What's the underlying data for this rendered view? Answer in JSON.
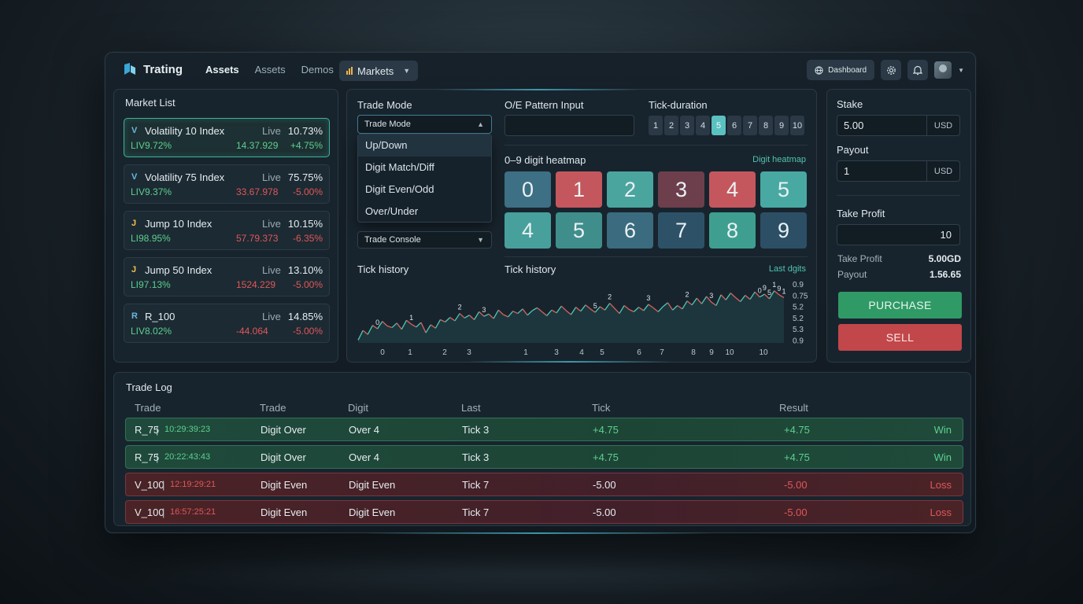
{
  "header": {
    "brand": "Trating",
    "nav": [
      "Assets",
      "Assets",
      "Demos"
    ],
    "markets_label": "Markets",
    "dashboard_label": "Dashboard"
  },
  "market_list": {
    "title": "Market List",
    "live_label": "Live",
    "items": [
      {
        "icon": "V",
        "name": "Volatility 10 Index",
        "pct": "10.73%",
        "sub": "LIV9.72%",
        "price": "14.37.929",
        "price_color": "green",
        "change": "+4.75%",
        "change_color": "green"
      },
      {
        "icon": "V",
        "name": "Volatility 75 Index",
        "pct": "75.75%",
        "sub": "LIV9.37%",
        "price": "33.67.978",
        "price_color": "red",
        "change": "-5.00%",
        "change_color": "red"
      },
      {
        "icon": "J",
        "name": "Jump 10 Index",
        "pct": "10.15%",
        "sub": "LI98.95%",
        "price": "57.79.373",
        "price_color": "red",
        "change": "-6.35%",
        "change_color": "red"
      },
      {
        "icon": "J",
        "name": "Jump 50 Index",
        "pct": "13.10%",
        "sub": "LI97.13%",
        "price": "1524.229",
        "price_color": "red",
        "change": "-5.00%",
        "change_color": "red"
      },
      {
        "icon": "R",
        "name": "R_100",
        "pct": "14.85%",
        "sub": "LIV8.02%",
        "price": "-44.064",
        "price_color": "red",
        "change": "-5.00%",
        "change_color": "red"
      }
    ]
  },
  "center": {
    "trade_mode_label": "Trade Mode",
    "trade_mode_value": "Trade Mode",
    "dropdown_options": [
      "Up/Down",
      "Digit Match/Diff",
      "Digit Even/Odd",
      "Over/Under"
    ],
    "trade_console_value": "Trade Console",
    "pattern_label": "O/E Pattern Input",
    "pattern_value": "",
    "tick_duration_label": "Tick-duration",
    "tick_options": [
      "1",
      "2",
      "3",
      "4",
      "5",
      "6",
      "7",
      "8",
      "9",
      "10"
    ],
    "tick_selected": "5",
    "heatmap_title": "0–9 digit heatmap",
    "heatmap_link": "Digit heatmap",
    "heatmap_cells": [
      {
        "digit": "0",
        "color": "#3d6f85"
      },
      {
        "digit": "1",
        "color": "#c4575d"
      },
      {
        "digit": "2",
        "color": "#4aa59e"
      },
      {
        "digit": "3",
        "color": "#6d3f4c"
      },
      {
        "digit": "4",
        "color": "#c4575d"
      },
      {
        "digit": "5",
        "color": "#48a9a3"
      },
      {
        "digit": "4",
        "color": "#47a09b"
      },
      {
        "digit": "5",
        "color": "#3f8e8c"
      },
      {
        "digit": "6",
        "color": "#3a6b7e"
      },
      {
        "digit": "7",
        "color": "#2d5268"
      },
      {
        "digit": "8",
        "color": "#3e9f90"
      },
      {
        "digit": "9",
        "color": "#2c4f66"
      }
    ],
    "tick_history_a": "Tick history",
    "tick_history_b": "Tick history",
    "last_digits_label": "Last dgits"
  },
  "chart_data": {
    "type": "line",
    "x_ticks": [
      "0",
      "1",
      "2",
      "3",
      "1",
      "3",
      "4",
      "5",
      "6",
      "7",
      "8",
      "9",
      "10",
      "10"
    ],
    "y_ticks": [
      "0.9",
      "0.75",
      "5.2",
      "5.2",
      "5.3",
      "0.9"
    ],
    "digit_annotations": [
      "0",
      "1",
      "2",
      "3",
      "5",
      "2",
      "3",
      "2",
      "3",
      "0",
      "9",
      "5",
      "1",
      "9",
      "1"
    ],
    "series": [
      {
        "values": [
          0.05,
          0.22,
          0.15,
          0.31,
          0.25,
          0.38,
          0.3,
          0.27,
          0.35,
          0.24,
          0.4,
          0.33,
          0.28,
          0.36,
          0.18,
          0.32,
          0.26,
          0.41,
          0.37,
          0.45,
          0.39,
          0.52,
          0.44,
          0.49,
          0.41,
          0.55,
          0.47,
          0.51,
          0.43,
          0.58,
          0.5,
          0.46,
          0.56,
          0.52,
          0.6,
          0.49,
          0.57,
          0.62,
          0.55,
          0.48,
          0.58,
          0.53,
          0.65,
          0.57,
          0.5,
          0.63,
          0.56,
          0.67,
          0.6,
          0.54,
          0.64,
          0.58,
          0.7,
          0.61,
          0.52,
          0.66,
          0.59,
          0.55,
          0.63,
          0.57,
          0.68,
          0.62,
          0.55,
          0.64,
          0.71,
          0.58,
          0.66,
          0.6,
          0.74,
          0.67,
          0.79,
          0.69,
          0.82,
          0.72,
          0.66,
          0.85,
          0.76,
          0.88,
          0.8,
          0.73,
          0.84,
          0.77,
          0.9,
          0.81,
          0.86,
          0.78,
          0.92,
          0.85,
          0.8
        ]
      }
    ]
  },
  "right": {
    "stake_label": "Stake",
    "stake_value": "5.00",
    "stake_unit": "USD",
    "payout_label": "Payout",
    "payout_value": "1",
    "payout_unit": "USD",
    "take_profit_label": "Take Profit",
    "take_profit_value": "10",
    "summary_tp_label": "Take Profit",
    "summary_tp_value": "5.00GD",
    "summary_payout_label": "Payout",
    "summary_payout_value": "1.56.65",
    "purchase_label": "PURCHASE",
    "sell_label": "SELL"
  },
  "trade_log": {
    "title": "Trade Log",
    "headers": [
      "Trade",
      "Trade",
      "Digit",
      "Last",
      "Tick",
      "Result"
    ],
    "rows": [
      {
        "type": "win",
        "symbol": "R_75",
        "time": "10:29:39:23",
        "trade": "Digit Over",
        "digit": "Over 4",
        "last": "Tick 3",
        "tick": "+4.75",
        "result": "+4.75",
        "status": "Win"
      },
      {
        "type": "win",
        "symbol": "R_75",
        "time": "20:22:43:43",
        "trade": "Digit Over",
        "digit": "Over 4",
        "last": "Tick 3",
        "tick": "+4.75",
        "result": "+4.75",
        "status": "Win"
      },
      {
        "type": "loss",
        "symbol": "V_100",
        "time": "12:19:29:21",
        "trade": "Digit Even",
        "digit": "Digit Even",
        "last": "Tick 7",
        "tick": "-5.00",
        "result": "-5.00",
        "status": "Loss"
      },
      {
        "type": "loss",
        "symbol": "V_100",
        "time": "16:57:25:21",
        "trade": "Digit Even",
        "digit": "Digit Even",
        "last": "Tick 7",
        "tick": "-5.00",
        "result": "-5.00",
        "status": "Loss"
      }
    ]
  },
  "colors": {
    "accent": "#4fc2b0",
    "win": "#5cd08f",
    "loss": "#e0575a",
    "purchase": "#2f9a65",
    "sell": "#c2474a"
  }
}
